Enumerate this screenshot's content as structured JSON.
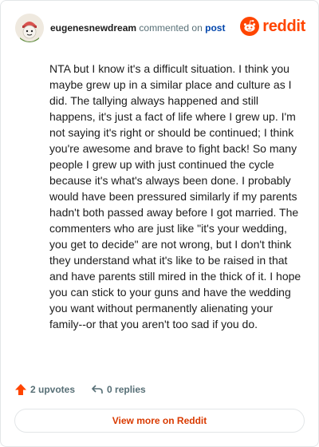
{
  "header": {
    "username": "eugenesnewdream",
    "action_text": "commented on",
    "post_link": "post",
    "brand": "reddit"
  },
  "comment": {
    "text": "NTA but I know it's a difficult situation. I think you maybe grew up in a similar place and culture as I did. The tallying always happened and still happens, it's just a fact of life where I grew up. I'm not saying it's right or should be continued; I think you're awesome and brave to fight back! So many people I grew up with just continued the cycle because it's what's always been done. I probably would have been pressured similarly if my parents hadn't both passed away before I got married. The commenters who are just like \"it's your wedding, you get to decide\" are not wrong, but I don't think they understand what it's like to be raised in that and have parents still mired in the thick of it. I hope you can stick to your guns and have the wedding you want without permanently alienating your family--or that you aren't too sad if you do."
  },
  "footer": {
    "upvotes": "2 upvotes",
    "replies": "0 replies",
    "view_more": "View more on Reddit"
  },
  "icons": {
    "upvote": "upvote-arrow-icon",
    "reply": "reply-arrow-icon",
    "reddit": "reddit-snoo-icon"
  },
  "colors": {
    "brand": "#ff4500",
    "link": "#0045ac",
    "view_more": "#d93a00",
    "muted": "#576f76"
  }
}
